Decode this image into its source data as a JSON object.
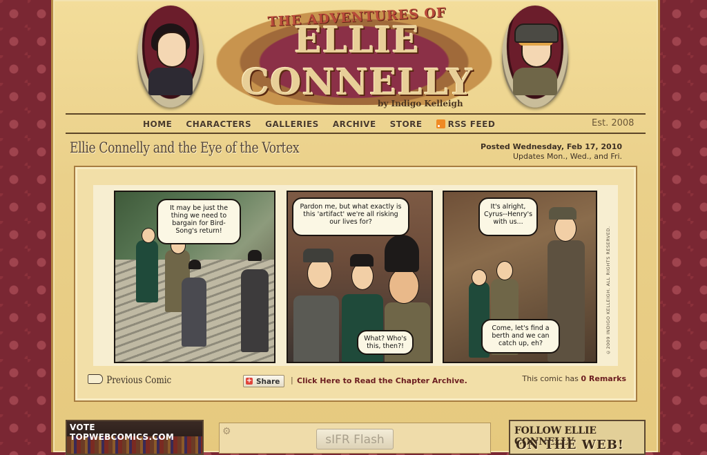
{
  "header": {
    "title_top": "THE ADVENTURES OF",
    "title_main": "ELLIE CONNELLY",
    "byline": "by Indigo Kelleigh",
    "est": "Est. 2008"
  },
  "nav": {
    "items": [
      {
        "label": "HOME"
      },
      {
        "label": "CHARACTERS"
      },
      {
        "label": "GALLERIES"
      },
      {
        "label": "ARCHIVE"
      },
      {
        "label": "STORE"
      }
    ],
    "rss_label": "RSS FEED"
  },
  "post": {
    "title": "Ellie Connelly and the Eye of the Vortex",
    "posted": "Posted Wednesday, Feb 17, 2010",
    "updates": "Updates Mon., Wed., and Fri."
  },
  "comic": {
    "panel1_bubble": "It may be just the thing we need to bargain for Bird-Song's return!",
    "panel2_bubble_top": "Pardon me, but what exactly is this 'artifact' we're all risking our lives for?",
    "panel2_bubble_bottom": "What? Who's this, then?!",
    "panel3_bubble_top": "It's alright, Cyrus--Henry's with us...",
    "panel3_bubble_bottom": "Come, let's find a berth and we can catch up, eh?",
    "copyright": "©2009 INDIGO KELLEIGH. ALL RIGHTS RESERVED."
  },
  "comic_footer": {
    "previous": "Previous Comic",
    "share": "Share",
    "separator": "|",
    "archive_link": "Click Here to Read the Chapter Archive.",
    "remarks_prefix": "This comic has ",
    "remarks_count": "0 Remarks"
  },
  "bottom": {
    "vote": "VOTE TOPWEBCOMICS.COM",
    "flash": "sIFR Flash",
    "follow_line1": "FOLLOW ELLIE CONNELLY",
    "follow_line2": "ON THE WEB!"
  },
  "colors": {
    "background": "#7a2733",
    "page": "#ead08a",
    "link": "#6b1d20"
  }
}
